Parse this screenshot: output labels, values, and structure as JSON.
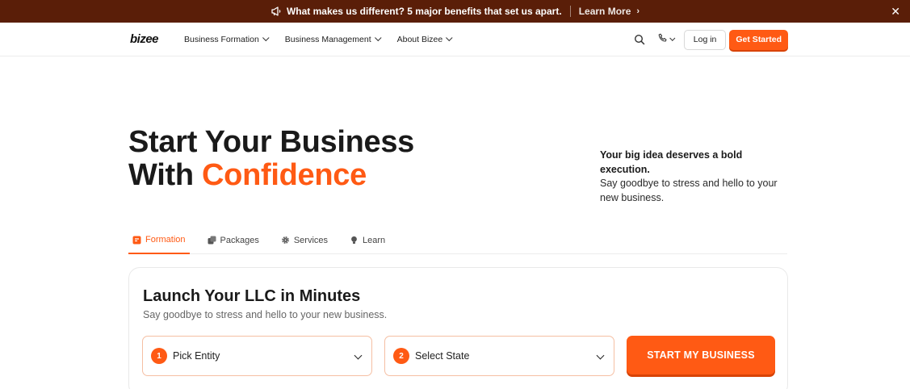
{
  "announcement": {
    "message": "What makes us different? 5 major benefits that set us apart.",
    "link_label": "Learn More",
    "icons": {
      "lead": "megaphone-icon",
      "link": "chevron-right-icon",
      "close": "close-icon"
    }
  },
  "nav": {
    "logo_text": "bizee",
    "menu": [
      {
        "label": "Business Formation"
      },
      {
        "label": "Business Management"
      },
      {
        "label": "About Bizee"
      }
    ],
    "icons": {
      "search": "search-icon",
      "phone": "phone-icon"
    },
    "login_label": "Log in",
    "cta_label": "Get Started"
  },
  "hero": {
    "title_line1": "Start Your Business",
    "title_line2_prefix": "With",
    "title_line2_accent": "Confidence",
    "side_strong": "Your big idea deserves a bold execution.",
    "side_text": "Say goodbye to stress and hello to your new business."
  },
  "tabs": [
    {
      "label": "Formation",
      "icon": "form-icon",
      "active": true
    },
    {
      "label": "Packages",
      "icon": "packages-icon",
      "active": false
    },
    {
      "label": "Services",
      "icon": "gear-icon",
      "active": false
    },
    {
      "label": "Learn",
      "icon": "lightbulb-icon",
      "active": false
    }
  ],
  "card": {
    "title": "Launch Your LLC in Minutes",
    "subtitle": "Say goodbye to stress and hello to your new business.",
    "step1": {
      "number": "1",
      "label": "Pick Entity"
    },
    "step2": {
      "number": "2",
      "label": "Select State"
    },
    "submit_label": "START MY BUSINESS"
  },
  "colors": {
    "brand_orange": "#ff5a14",
    "announcement_bg": "#5a1e08",
    "text_dark": "#1a1a1a"
  }
}
